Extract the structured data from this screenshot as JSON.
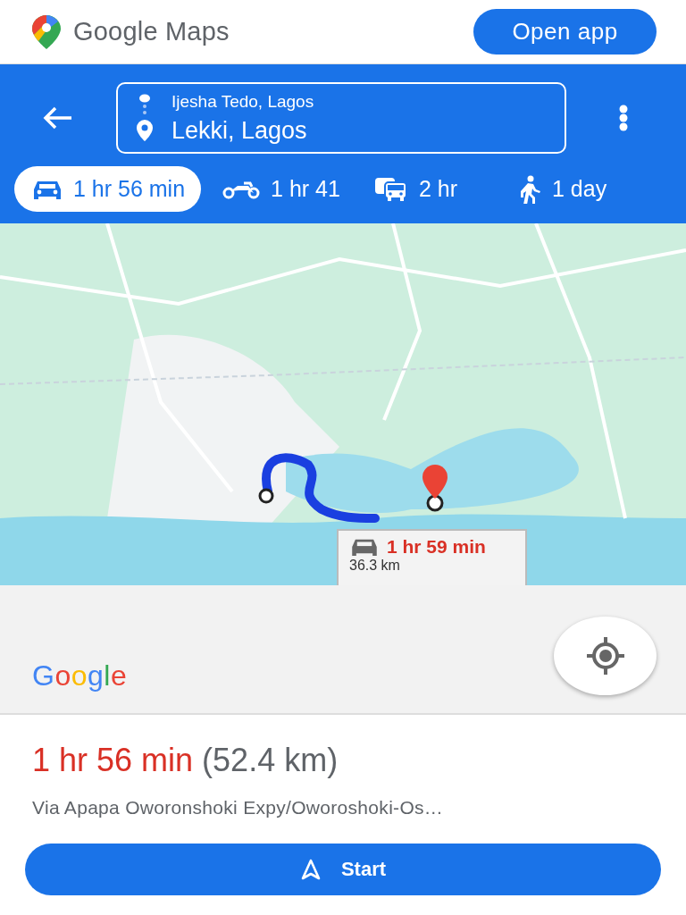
{
  "header": {
    "brand": "Google Maps",
    "open_app": "Open app"
  },
  "directions": {
    "origin": "Ijesha Tedo, Lagos",
    "destination": "Lekki, Lagos"
  },
  "modes": [
    {
      "kind": "car",
      "label": "1 hr 56 min",
      "selected": true
    },
    {
      "kind": "motorbike",
      "label": "1 hr 41",
      "selected": false
    },
    {
      "kind": "transit",
      "label": "2 hr",
      "selected": false
    },
    {
      "kind": "walk",
      "label": "1 day",
      "selected": false
    }
  ],
  "map": {
    "kind": "picture",
    "callout": {
      "duration": "1 hr 59 min",
      "distance": "36.3 km"
    },
    "logo": "Google"
  },
  "summary": {
    "duration": "1 hr 56 min",
    "distance": "(52.4 km)",
    "via": "Via Apapa Oworonshoki Expy/Oworoshoki-Os…",
    "start": "Start"
  }
}
